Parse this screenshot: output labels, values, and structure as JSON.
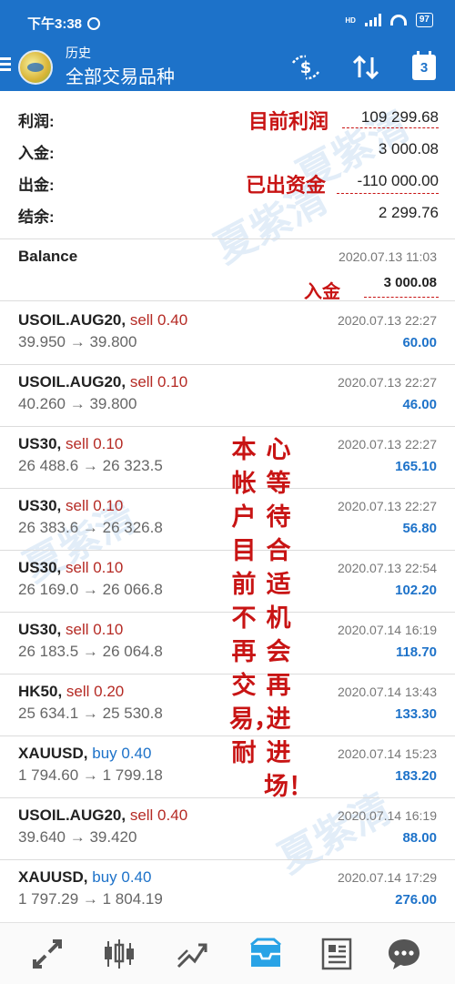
{
  "status_bar": {
    "time": "下午3:38",
    "signal": "HD",
    "battery": "97"
  },
  "toolbar": {
    "subtitle": "历史",
    "title": "全部交易品种",
    "calendar_day": "3"
  },
  "summary": [
    {
      "label": "利润:",
      "value": "109 299.68"
    },
    {
      "label": "入金:",
      "value": "3 000.08"
    },
    {
      "label": "出金:",
      "value": "-110 000.00"
    },
    {
      "label": "结余:",
      "value": "2 299.76"
    }
  ],
  "balance": {
    "title": "Balance",
    "date": "2020.07.13 11:03",
    "amount": "3 000.08"
  },
  "deals": [
    {
      "symbol": "USOIL.AUG20,",
      "side": "sell 0.40",
      "type": "sell",
      "prices": "39.950 → 39.800",
      "date": "2020.07.13 22:27",
      "profit": "60.00"
    },
    {
      "symbol": "USOIL.AUG20,",
      "side": "sell 0.10",
      "type": "sell",
      "prices": "40.260 → 39.800",
      "date": "2020.07.13 22:27",
      "profit": "46.00"
    },
    {
      "symbol": "US30,",
      "side": "sell 0.10",
      "type": "sell",
      "prices": "26 488.6 → 26 323.5",
      "date": "2020.07.13 22:27",
      "profit": "165.10"
    },
    {
      "symbol": "US30,",
      "side": "sell 0.10",
      "type": "sell",
      "prices": "26 383.6 → 26 326.8",
      "date": "2020.07.13 22:27",
      "profit": "56.80"
    },
    {
      "symbol": "US30,",
      "side": "sell 0.10",
      "type": "sell",
      "prices": "26 169.0 → 26 066.8",
      "date": "2020.07.13 22:54",
      "profit": "102.20"
    },
    {
      "symbol": "US30,",
      "side": "sell 0.10",
      "type": "sell",
      "prices": "26 183.5 → 26 064.8",
      "date": "2020.07.14 16:19",
      "profit": "118.70"
    },
    {
      "symbol": "HK50,",
      "side": "sell 0.20",
      "type": "sell",
      "prices": "25 634.1 → 25 530.8",
      "date": "2020.07.14 13:43",
      "profit": "133.30"
    },
    {
      "symbol": "XAUUSD,",
      "side": "buy 0.40",
      "type": "buy",
      "prices": "1 794.60 → 1 799.18",
      "date": "2020.07.14 15:23",
      "profit": "183.20"
    },
    {
      "symbol": "USOIL.AUG20,",
      "side": "sell 0.40",
      "type": "sell",
      "prices": "39.640 → 39.420",
      "date": "2020.07.14 16:19",
      "profit": "88.00"
    },
    {
      "symbol": "XAUUSD,",
      "side": "buy 0.40",
      "type": "buy",
      "prices": "1 797.29 → 1 804.19",
      "date": "2020.07.14 17:29",
      "profit": "276.00"
    }
  ],
  "annotations": {
    "current_profit": "目前利润",
    "withdrawn": "已出资金",
    "deposit": "入金",
    "note_left": "本帐户目前不再交易，耐",
    "note_right": "心等待合适机会再进进场！"
  },
  "watermark": "夏紫清",
  "bottom_nav": [
    {
      "icon": "quotes-icon"
    },
    {
      "icon": "chart-icon"
    },
    {
      "icon": "trade-icon"
    },
    {
      "icon": "history-icon",
      "active": true
    },
    {
      "icon": "news-icon"
    },
    {
      "icon": "messages-icon"
    }
  ],
  "colors": {
    "accent": "#1d72c9",
    "sell": "#b52a24",
    "annotation": "#c81414"
  }
}
